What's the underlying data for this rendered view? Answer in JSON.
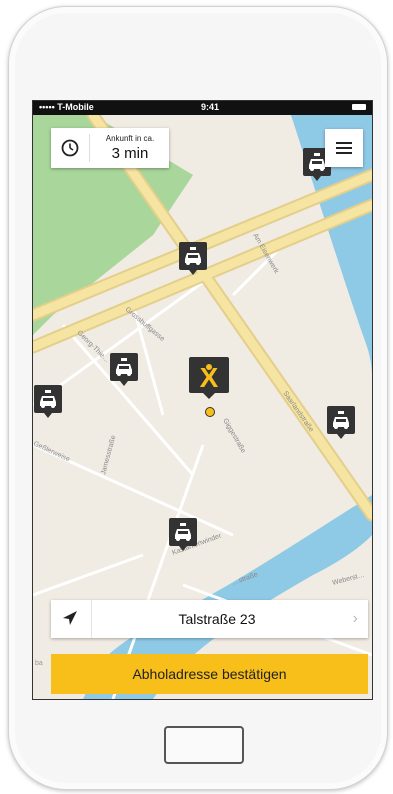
{
  "status_bar": {
    "carrier": "••••• T-Mobile",
    "time": "9:41"
  },
  "eta": {
    "label": "Ankunft in ca.",
    "value": "3 min",
    "icon": "clock-icon"
  },
  "menu": {
    "icon": "hamburger-menu-icon"
  },
  "map": {
    "street_labels": [
      "Saarlandstraße",
      "Grosshuffgasse",
      "Georg-Thie…",
      "Am Eisenwerk",
      "Giggestraße",
      "Jamesstraße",
      "Geßlerweise",
      "Kastanienwinder",
      "Weberst…",
      "…straße"
    ],
    "taxi_icon": "taxi-icon",
    "logo_letter": "X",
    "colors": {
      "land": "#f0ebe3",
      "park": "#a9d69a",
      "water": "#8ec9e6",
      "major_road": "#f6e4a3",
      "pin": "#333333",
      "logo": "#f8bf1a"
    }
  },
  "address": {
    "text": "Talstraße 23",
    "chevron": "›",
    "icon": "location-arrow-icon"
  },
  "confirm_button": {
    "label": "Abholadresse bestätigen",
    "color": "#f8bf1a"
  }
}
